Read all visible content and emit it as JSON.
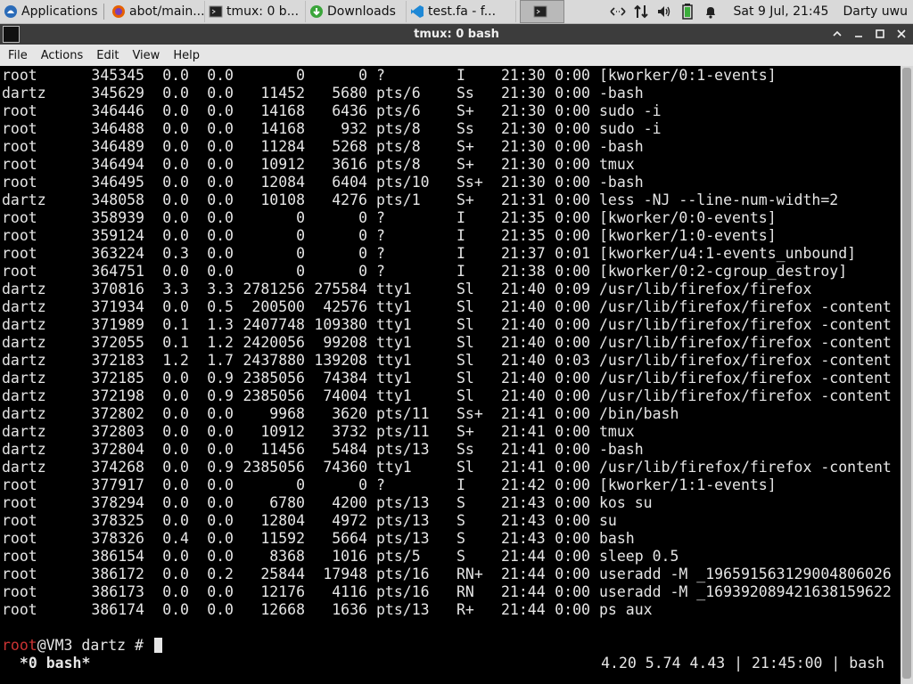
{
  "taskbar": {
    "apps_label": "Applications",
    "tasks": [
      {
        "label": "abot/main...",
        "icon": "firefox-icon"
      },
      {
        "label": "tmux: 0 b...",
        "icon": "terminal-icon"
      },
      {
        "label": "Downloads",
        "icon": "download-icon"
      },
      {
        "label": "test.fa - f...",
        "icon": "vscode-icon"
      },
      {
        "label": "",
        "icon": "terminal-icon"
      }
    ],
    "clock": "Sat  9 Jul, 21:45",
    "user": "Darty uwu"
  },
  "window": {
    "title": "tmux: 0 bash"
  },
  "menu": [
    "File",
    "Actions",
    "Edit",
    "View",
    "Help"
  ],
  "ps_rows": [
    [
      "root",
      "345345",
      "0.0",
      "0.0",
      "0",
      "0",
      "?",
      "I",
      "21:30",
      "0:00",
      "[kworker/0:1-events]"
    ],
    [
      "dartz",
      "345629",
      "0.0",
      "0.0",
      "11452",
      "5680",
      "pts/6",
      "Ss",
      "21:30",
      "0:00",
      "-bash"
    ],
    [
      "root",
      "346446",
      "0.0",
      "0.0",
      "14168",
      "6436",
      "pts/6",
      "S+",
      "21:30",
      "0:00",
      "sudo -i"
    ],
    [
      "root",
      "346488",
      "0.0",
      "0.0",
      "14168",
      "932",
      "pts/8",
      "Ss",
      "21:30",
      "0:00",
      "sudo -i"
    ],
    [
      "root",
      "346489",
      "0.0",
      "0.0",
      "11284",
      "5268",
      "pts/8",
      "S+",
      "21:30",
      "0:00",
      "-bash"
    ],
    [
      "root",
      "346494",
      "0.0",
      "0.0",
      "10912",
      "3616",
      "pts/8",
      "S+",
      "21:30",
      "0:00",
      "tmux"
    ],
    [
      "root",
      "346495",
      "0.0",
      "0.0",
      "12084",
      "6404",
      "pts/10",
      "Ss+",
      "21:30",
      "0:00",
      "-bash"
    ],
    [
      "dartz",
      "348058",
      "0.0",
      "0.0",
      "10108",
      "4276",
      "pts/1",
      "S+",
      "21:31",
      "0:00",
      "less -NJ --line-num-width=2"
    ],
    [
      "root",
      "358939",
      "0.0",
      "0.0",
      "0",
      "0",
      "?",
      "I",
      "21:35",
      "0:00",
      "[kworker/0:0-events]"
    ],
    [
      "root",
      "359124",
      "0.0",
      "0.0",
      "0",
      "0",
      "?",
      "I",
      "21:35",
      "0:00",
      "[kworker/1:0-events]"
    ],
    [
      "root",
      "363224",
      "0.3",
      "0.0",
      "0",
      "0",
      "?",
      "I",
      "21:37",
      "0:01",
      "[kworker/u4:1-events_unbound]"
    ],
    [
      "root",
      "364751",
      "0.0",
      "0.0",
      "0",
      "0",
      "?",
      "I",
      "21:38",
      "0:00",
      "[kworker/0:2-cgroup_destroy]"
    ],
    [
      "dartz",
      "370816",
      "3.3",
      "3.3",
      "2781256",
      "275584",
      "tty1",
      "Sl",
      "21:40",
      "0:09",
      "/usr/lib/firefox/firefox"
    ],
    [
      "dartz",
      "371934",
      "0.0",
      "0.5",
      "200500",
      "42576",
      "tty1",
      "Sl",
      "21:40",
      "0:00",
      "/usr/lib/firefox/firefox -content"
    ],
    [
      "dartz",
      "371989",
      "0.1",
      "1.3",
      "2407748",
      "109380",
      "tty1",
      "Sl",
      "21:40",
      "0:00",
      "/usr/lib/firefox/firefox -content"
    ],
    [
      "dartz",
      "372055",
      "0.1",
      "1.2",
      "2420056",
      "99208",
      "tty1",
      "Sl",
      "21:40",
      "0:00",
      "/usr/lib/firefox/firefox -content"
    ],
    [
      "dartz",
      "372183",
      "1.2",
      "1.7",
      "2437880",
      "139208",
      "tty1",
      "Sl",
      "21:40",
      "0:03",
      "/usr/lib/firefox/firefox -content"
    ],
    [
      "dartz",
      "372185",
      "0.0",
      "0.9",
      "2385056",
      "74384",
      "tty1",
      "Sl",
      "21:40",
      "0:00",
      "/usr/lib/firefox/firefox -content"
    ],
    [
      "dartz",
      "372198",
      "0.0",
      "0.9",
      "2385056",
      "74004",
      "tty1",
      "Sl",
      "21:40",
      "0:00",
      "/usr/lib/firefox/firefox -content"
    ],
    [
      "dartz",
      "372802",
      "0.0",
      "0.0",
      "9968",
      "3620",
      "pts/11",
      "Ss+",
      "21:41",
      "0:00",
      "/bin/bash"
    ],
    [
      "dartz",
      "372803",
      "0.0",
      "0.0",
      "10912",
      "3732",
      "pts/11",
      "S+",
      "21:41",
      "0:00",
      "tmux"
    ],
    [
      "dartz",
      "372804",
      "0.0",
      "0.0",
      "11456",
      "5484",
      "pts/13",
      "Ss",
      "21:41",
      "0:00",
      "-bash"
    ],
    [
      "dartz",
      "374268",
      "0.0",
      "0.9",
      "2385056",
      "74360",
      "tty1",
      "Sl",
      "21:41",
      "0:00",
      "/usr/lib/firefox/firefox -content"
    ],
    [
      "root",
      "377917",
      "0.0",
      "0.0",
      "0",
      "0",
      "?",
      "I",
      "21:42",
      "0:00",
      "[kworker/1:1-events]"
    ],
    [
      "root",
      "378294",
      "0.0",
      "0.0",
      "6780",
      "4200",
      "pts/13",
      "S",
      "21:43",
      "0:00",
      "kos su"
    ],
    [
      "root",
      "378325",
      "0.0",
      "0.0",
      "12804",
      "4972",
      "pts/13",
      "S",
      "21:43",
      "0:00",
      "su"
    ],
    [
      "root",
      "378326",
      "0.4",
      "0.0",
      "11592",
      "5664",
      "pts/13",
      "S",
      "21:43",
      "0:00",
      "bash"
    ],
    [
      "root",
      "386154",
      "0.0",
      "0.0",
      "8368",
      "1016",
      "pts/5",
      "S",
      "21:44",
      "0:00",
      "sleep 0.5"
    ],
    [
      "root",
      "386172",
      "0.0",
      "0.2",
      "25844",
      "17948",
      "pts/16",
      "RN+",
      "21:44",
      "0:00",
      "useradd -M _196591563129004806026"
    ],
    [
      "root",
      "386173",
      "0.0",
      "0.0",
      "12176",
      "4116",
      "pts/16",
      "RN",
      "21:44",
      "0:00",
      "useradd -M _169392089421638159622"
    ],
    [
      "root",
      "386174",
      "0.0",
      "0.0",
      "12668",
      "1636",
      "pts/13",
      "R+",
      "21:44",
      "0:00",
      "ps aux"
    ]
  ],
  "prompt": {
    "user": "root",
    "rest": "@VM3 dartz # "
  },
  "tmux_status": {
    "window": " *0 bash*",
    "right": "4.20 5.74 4.43 | 21:45:00 | bash"
  },
  "colors": {
    "prompt_user": "#cc3333",
    "terminal_bg": "#000000",
    "terminal_fg": "#e6e6e6"
  }
}
